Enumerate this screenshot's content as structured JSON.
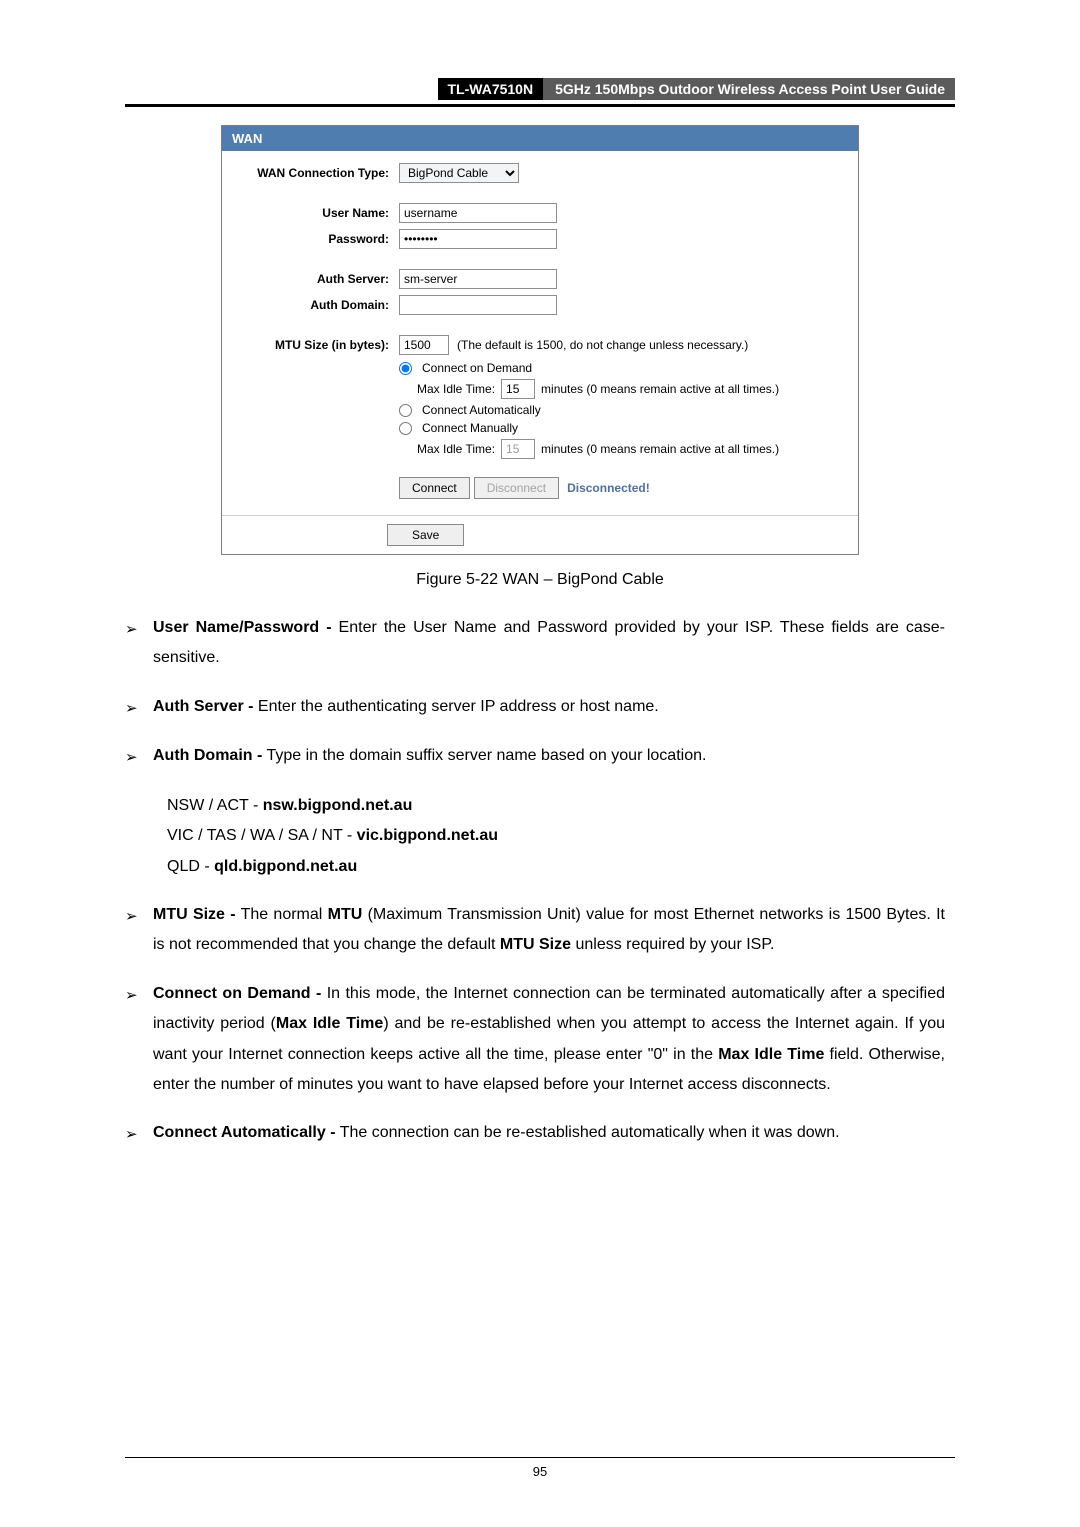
{
  "header": {
    "model": "TL-WA7510N",
    "title": "5GHz 150Mbps Outdoor Wireless Access Point User Guide"
  },
  "screenshot": {
    "panel_title": "WAN",
    "labels": {
      "conn_type": "WAN Connection Type:",
      "user": "User Name:",
      "pass": "Password:",
      "auth_server": "Auth Server:",
      "auth_domain": "Auth Domain:",
      "mtu": "MTU Size (in bytes):"
    },
    "values": {
      "conn_type": "BigPond Cable",
      "user": "username",
      "pass": "••••••••",
      "auth_server": "sm-server",
      "auth_domain": "",
      "mtu": "1500",
      "idle1": "15",
      "idle2": "15"
    },
    "hints": {
      "mtu_note": "(The default is 1500, do not change unless necessary.)",
      "idle_pre": "Max Idle Time:",
      "idle_post": "minutes (0 means remain active at all times.)"
    },
    "radios": {
      "on_demand": "Connect on Demand",
      "auto": "Connect Automatically",
      "manual": "Connect Manually"
    },
    "buttons": {
      "connect": "Connect",
      "disconnect": "Disconnect",
      "save": "Save"
    },
    "status": "Disconnected!"
  },
  "caption": "Figure 5-22 WAN – BigPond Cable",
  "bullets": {
    "b1": {
      "bold": "User Name/Password -",
      "rest": " Enter the User Name and Password provided by your ISP. These fields are case-sensitive."
    },
    "b2": {
      "bold": "Auth Server -",
      "rest": " Enter the authenticating server IP address or host name."
    },
    "b3": {
      "bold": "Auth Domain -",
      "rest": " Type in the domain suffix server name based on your location."
    },
    "domains": {
      "l1a": "NSW / ACT - ",
      "l1b": "nsw.bigpond.net.au",
      "l2a": "VIC / TAS / WA / SA / NT - ",
      "l2b": "vic.bigpond.net.au",
      "l3a": "QLD - ",
      "l3b": "qld.bigpond.net.au"
    },
    "b4": {
      "bold1": "MTU Size -",
      "t1": " The normal ",
      "bold2": "MTU",
      "t2": " (Maximum Transmission Unit) value for most Ethernet networks is 1500 Bytes. It is not recommended that you change the default ",
      "bold3": "MTU Size",
      "t3": " unless required by your ISP."
    },
    "b5": {
      "bold1": "Connect on Demand -",
      "t1": " In this mode, the Internet connection can be terminated automatically after a specified inactivity period (",
      "bold2": "Max Idle Time",
      "t2": ") and be re-established when you attempt to access the Internet again. If you want your Internet connection keeps active all the time, please enter \"0\" in the ",
      "bold3": "Max Idle Time",
      "t3": " field. Otherwise, enter the number of minutes you want to have elapsed before your Internet access disconnects."
    },
    "b6": {
      "bold": "Connect Automatically -",
      "rest": " The connection can be re-established automatically when it was down."
    }
  },
  "page_number": "95",
  "marker": "➢"
}
